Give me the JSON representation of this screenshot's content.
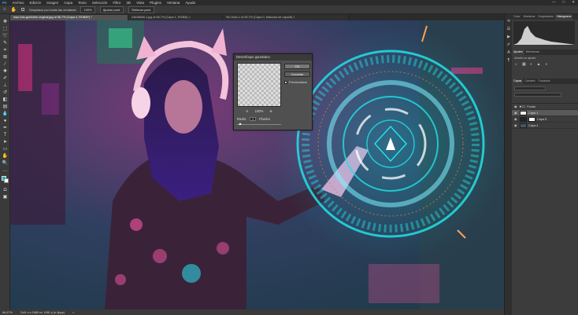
{
  "menu": {
    "items": [
      "Archivo",
      "Edición",
      "Imagen",
      "Capa",
      "Texto",
      "Selección",
      "Filtro",
      "3D",
      "Vista",
      "Plugins",
      "Ventana",
      "Ayuda"
    ],
    "window_controls": [
      "—",
      "□",
      "✕"
    ]
  },
  "options_bar": {
    "sample_all_windows_label": "Desplazar por todas las ventanas",
    "zoom_value": "100%",
    "fit_screen_label": "Ajustar pant.",
    "fill_screen_label": "Rellenar pant."
  },
  "document_tabs": [
    {
      "label": "mac-foto-gorlicfxtv-original.jpg al 66,7% (Capa 4, RGB/8*) *",
      "active": true
    },
    {
      "label": "× ",
      "active": false
    },
    {
      "label": "43838666-1.jpg al 66,7% (Capa 1, RGB/8) ×",
      "active": false
    },
    {
      "label": "Sin título-1 al 55,7% (Capa 0, Máscara de capa/8) ×",
      "active": false
    }
  ],
  "status_bar": {
    "zoom": "66,67%",
    "doc_info": "Dcfl: n.s 1680 ex 1080 p (e 8ppp)",
    "arrow": ">"
  },
  "dialog": {
    "title": "Desenfoque gaussiano",
    "ok_label": "OK",
    "cancel_label": "Cancelar",
    "preview_label": "Previsualizar",
    "preview_checked": true,
    "zoom_out": "⊖",
    "zoom_level": "100%",
    "zoom_in": "⊕",
    "radius_label": "Radio:",
    "radius_value": "1",
    "radius_unit": "Píxeles"
  },
  "panels": {
    "top_tabs": [
      "Color",
      "Muestras",
      "Degradados",
      "Histograma"
    ],
    "adjust_tabs": [
      "Ajustes",
      "Bibliotecas"
    ],
    "adjust_hint": "Añadir un ajuste",
    "layer_tabs": [
      "Capas",
      "Canales",
      "Trazados"
    ],
    "layers": [
      {
        "name": "Fondo",
        "visible": true,
        "selected": false
      },
      {
        "name": "Capa 1",
        "visible": true,
        "selected": true
      },
      {
        "name": "Capa 5",
        "visible": true,
        "selected": false
      },
      {
        "name": "Capa 4",
        "visible": true,
        "selected": false
      }
    ]
  },
  "colors": {
    "ui_dark": "#2b2b2b",
    "panel": "#3c3c3c",
    "canvas_bg": "#2d4450",
    "neon_cyan": "#21e1e6",
    "neon_pink": "#e0308f"
  }
}
